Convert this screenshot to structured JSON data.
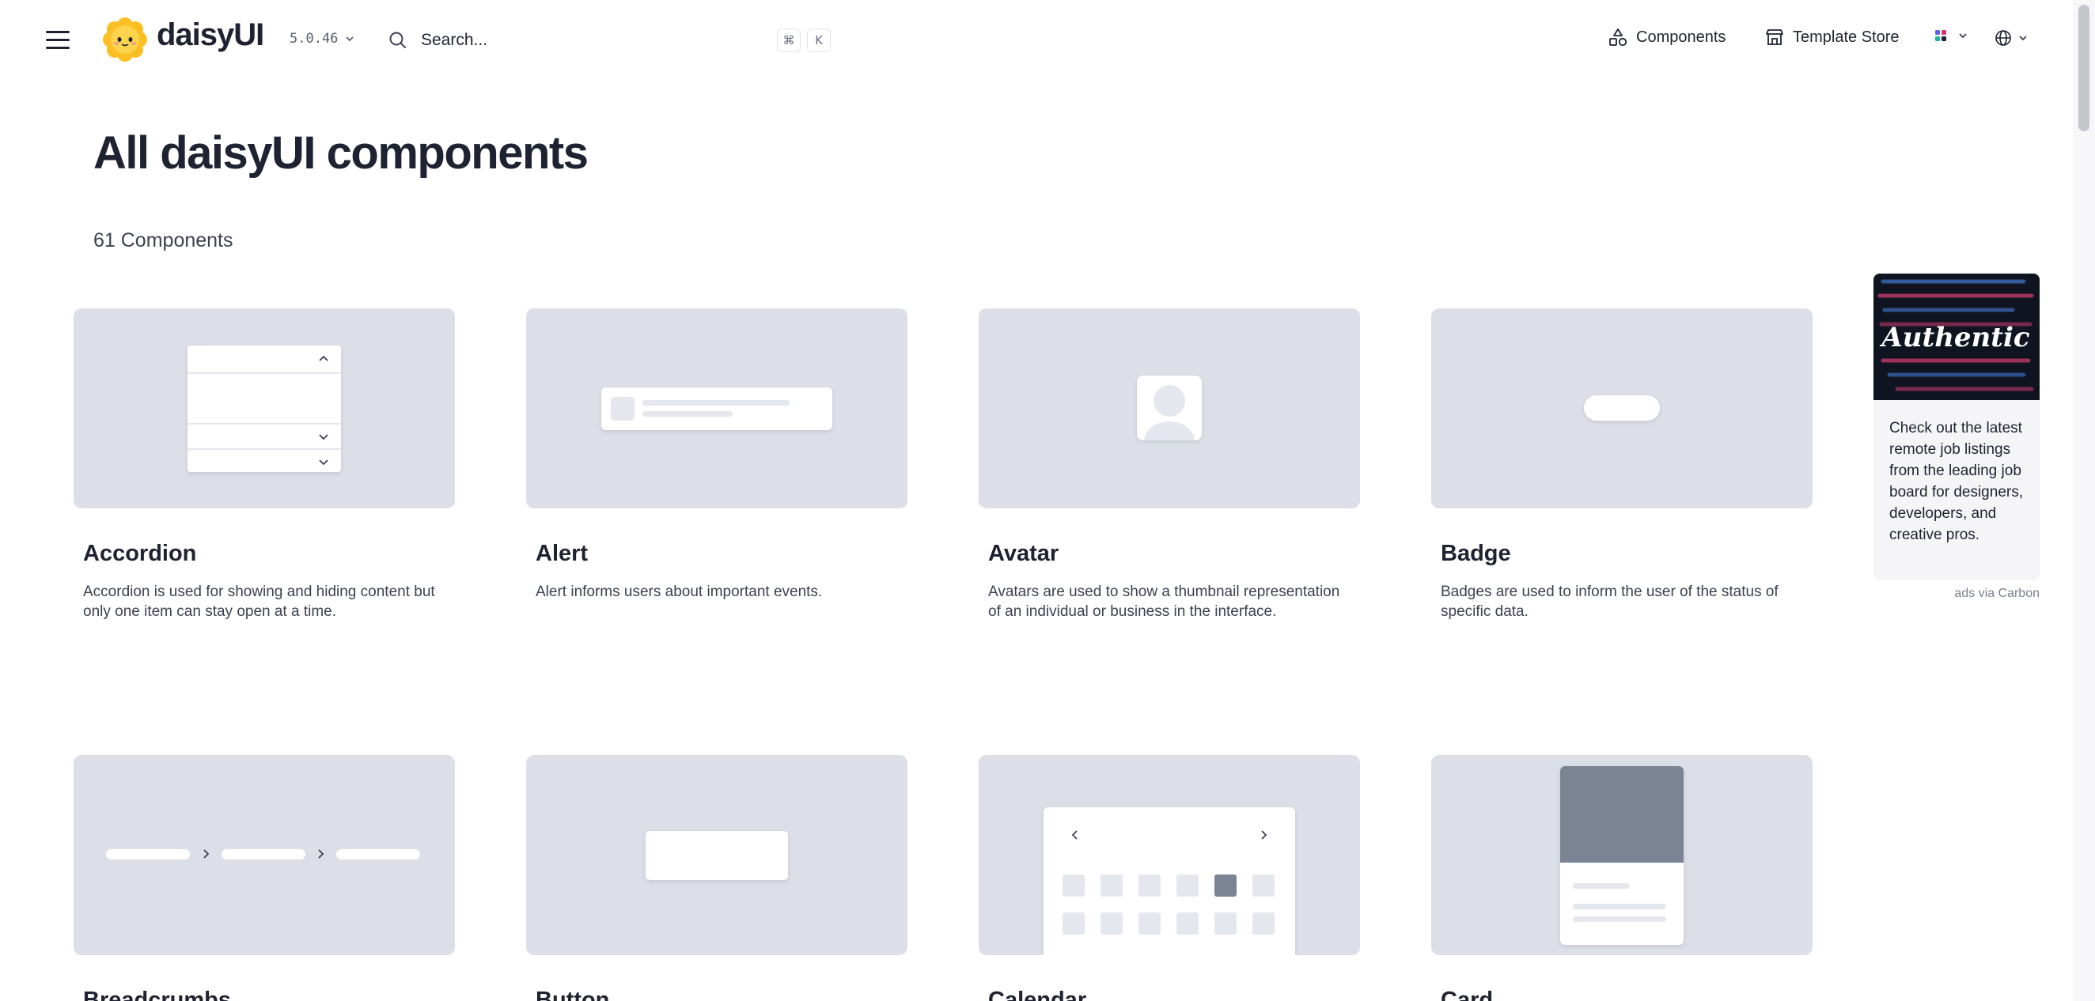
{
  "header": {
    "brand": "daisyUI",
    "version": "5.0.46",
    "search_placeholder": "Search...",
    "kbd_cmd": "⌘",
    "kbd_k": "K",
    "nav_components": "Components",
    "nav_template_store": "Template Store"
  },
  "page": {
    "title": "All daisyUI components",
    "count": "61 Components"
  },
  "cards": [
    {
      "title": "Accordion",
      "description": "Accordion is used for showing and hiding content but only one item can stay open at a time."
    },
    {
      "title": "Alert",
      "description": "Alert informs users about important events."
    },
    {
      "title": "Avatar",
      "description": "Avatars are used to show a thumbnail representation of an individual or business in the interface."
    },
    {
      "title": "Badge",
      "description": "Badges are used to inform the user of the status of specific data."
    },
    {
      "title": "Breadcrumbs",
      "description": ""
    },
    {
      "title": "Button",
      "description": ""
    },
    {
      "title": "Calendar",
      "description": ""
    },
    {
      "title": "Card",
      "description": ""
    }
  ],
  "ad": {
    "image_text": "Authentic",
    "text": "Check out the latest remote job listings from the leading job board for designers, developers, and creative pros.",
    "via": "ads via Carbon"
  },
  "colors": {
    "thumb_bg": "#dcdfe7",
    "placeholder": "#e5e7ee",
    "accent_dark": "#7b8494",
    "text": "#1f2230"
  }
}
